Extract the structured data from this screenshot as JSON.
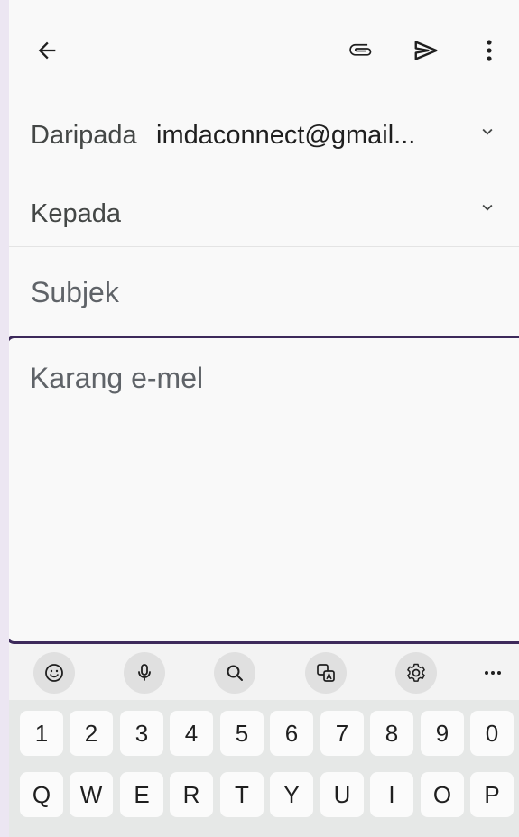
{
  "compose": {
    "from_label": "Daripada",
    "from_value": "imdaconnect@gmail...",
    "to_label": "Kepada",
    "subject_placeholder": "Subjek",
    "body_placeholder": "Karang e-mel"
  },
  "appbar": {
    "icons": [
      "back-arrow-icon",
      "paperclip-icon",
      "send-icon",
      "more-vert-icon"
    ]
  },
  "keyboard": {
    "toolbar_icons": [
      "emoji-icon",
      "mic-icon",
      "search-icon",
      "translate-icon",
      "settings-icon",
      "more-horiz-icon"
    ],
    "number_row": [
      "1",
      "2",
      "3",
      "4",
      "5",
      "6",
      "7",
      "8",
      "9",
      "0"
    ],
    "letter_row": [
      "Q",
      "W",
      "E",
      "R",
      "T",
      "Y",
      "U",
      "I",
      "O",
      "P"
    ]
  },
  "colors": {
    "accent_border": "#3d2a5b",
    "page_bg": "#ece6f2",
    "surface": "#f9f9f9"
  }
}
